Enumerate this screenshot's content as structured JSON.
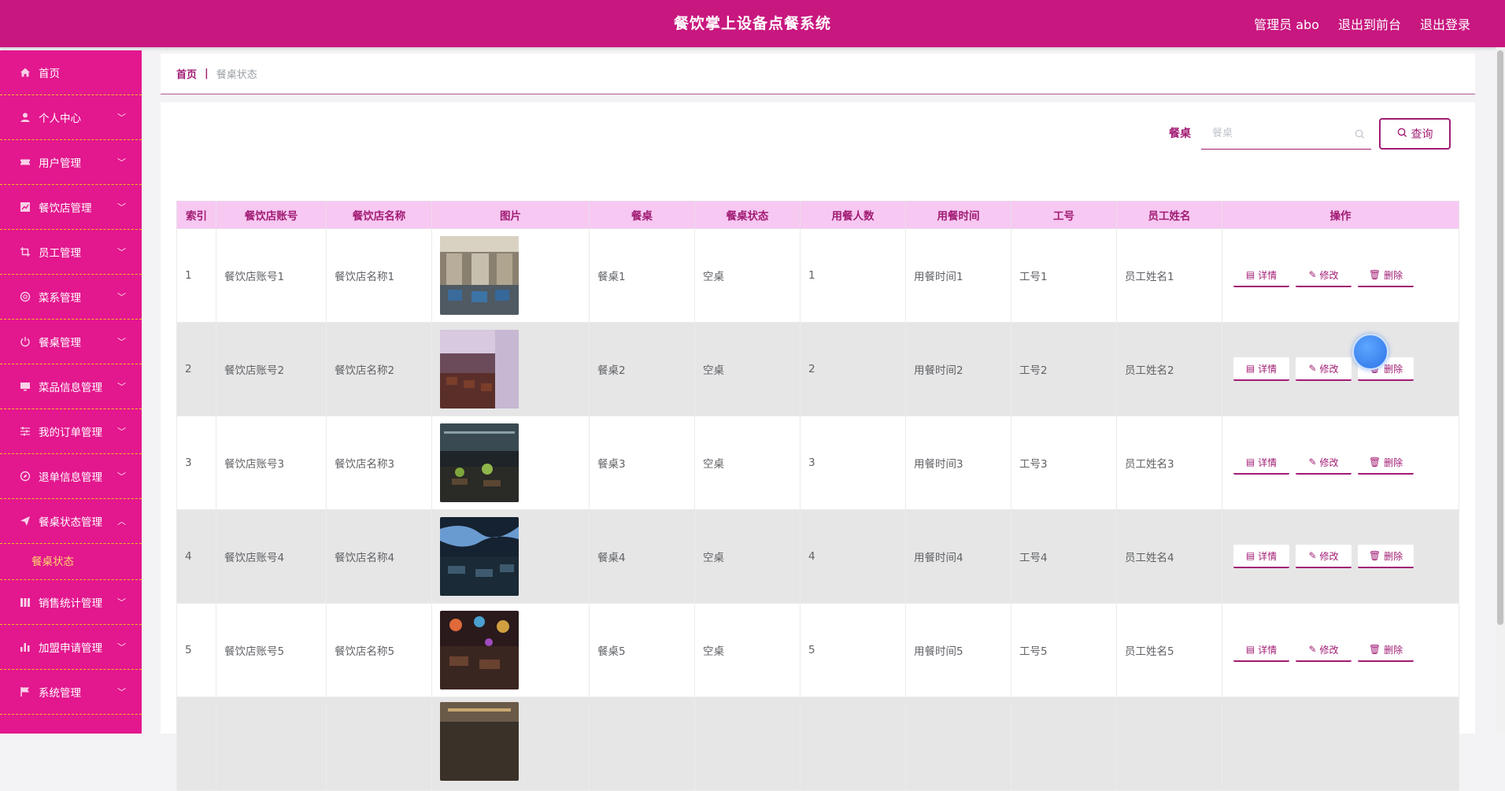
{
  "header": {
    "title": "餐饮掌上设备点餐系统",
    "admin_label": "管理员 abo",
    "frontend_link": "退出到前台",
    "logout_link": "退出登录"
  },
  "sidebar": {
    "items": [
      {
        "label": "首页",
        "icon": "home-icon"
      },
      {
        "label": "个人中心",
        "icon": "user-icon"
      },
      {
        "label": "用户管理",
        "icon": "ticket-icon"
      },
      {
        "label": "餐饮店管理",
        "icon": "chart-icon"
      },
      {
        "label": "员工管理",
        "icon": "crop-icon"
      },
      {
        "label": "菜系管理",
        "icon": "circle-icon"
      },
      {
        "label": "餐桌管理",
        "icon": "power-icon"
      },
      {
        "label": "菜品信息管理",
        "icon": "monitor-icon"
      },
      {
        "label": "我的订单管理",
        "icon": "sliders-icon"
      },
      {
        "label": "退单信息管理",
        "icon": "compass-icon"
      },
      {
        "label": "餐桌状态管理",
        "icon": "send-icon"
      },
      {
        "label": "销售统计管理",
        "icon": "columns-icon"
      },
      {
        "label": "加盟申请管理",
        "icon": "bar-chart-icon"
      },
      {
        "label": "系统管理",
        "icon": "flag-icon"
      }
    ],
    "submenu": {
      "label": "餐桌状态"
    }
  },
  "breadcrumb": {
    "home": "首页",
    "separator": "|",
    "current": "餐桌状态"
  },
  "search": {
    "label": "餐桌",
    "placeholder": "餐桌",
    "button": "查询"
  },
  "table": {
    "headers": [
      "索引",
      "餐饮店账号",
      "餐饮店名称",
      "图片",
      "餐桌",
      "餐桌状态",
      "用餐人数",
      "用餐时间",
      "工号",
      "员工姓名",
      "操作"
    ],
    "rows": [
      {
        "index": "1",
        "account": "餐饮店账号1",
        "name": "餐饮店名称1",
        "table": "餐桌1",
        "status": "空桌",
        "people": "1",
        "time": "用餐时间1",
        "staff_no": "工号1",
        "staff_name": "员工姓名1"
      },
      {
        "index": "2",
        "account": "餐饮店账号2",
        "name": "餐饮店名称2",
        "table": "餐桌2",
        "status": "空桌",
        "people": "2",
        "time": "用餐时间2",
        "staff_no": "工号2",
        "staff_name": "员工姓名2"
      },
      {
        "index": "3",
        "account": "餐饮店账号3",
        "name": "餐饮店名称3",
        "table": "餐桌3",
        "status": "空桌",
        "people": "3",
        "time": "用餐时间3",
        "staff_no": "工号3",
        "staff_name": "员工姓名3"
      },
      {
        "index": "4",
        "account": "餐饮店账号4",
        "name": "餐饮店名称4",
        "table": "餐桌4",
        "status": "空桌",
        "people": "4",
        "time": "用餐时间4",
        "staff_no": "工号4",
        "staff_name": "员工姓名4"
      },
      {
        "index": "5",
        "account": "餐饮店账号5",
        "name": "餐饮店名称5",
        "table": "餐桌5",
        "status": "空桌",
        "people": "5",
        "time": "用餐时间5",
        "staff_no": "工号5",
        "staff_name": "员工姓名5"
      },
      {
        "index": "",
        "account": "",
        "name": "",
        "table": "",
        "status": "",
        "people": "",
        "time": "",
        "staff_no": "",
        "staff_name": ""
      }
    ],
    "actions": {
      "detail": "详情",
      "edit": "修改",
      "delete": "删除"
    }
  },
  "colors": {
    "topbar": "#c8177f",
    "sidebar": "#e3178e",
    "accent": "#a11c73",
    "header_row": "#f7c8f2",
    "submenu_active": "#ffd86b"
  }
}
